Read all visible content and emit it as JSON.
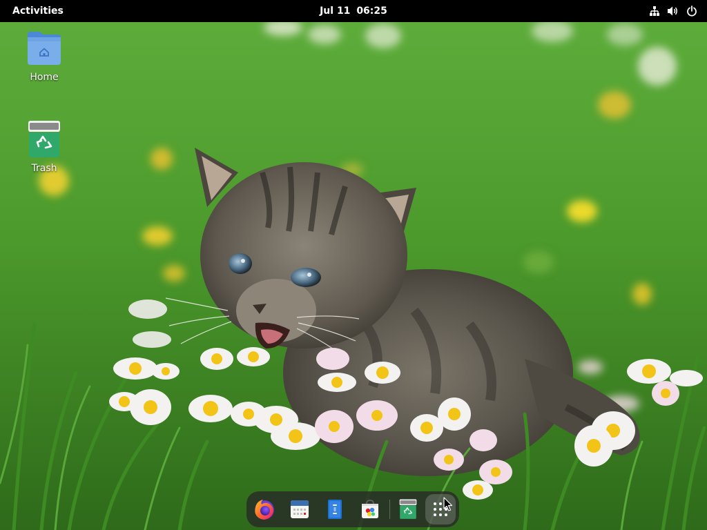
{
  "topbar": {
    "activities_label": "Activities",
    "date": "Jul 11",
    "time": "06:25",
    "status_icons": [
      "network-wired-icon",
      "volume-icon",
      "power-icon"
    ]
  },
  "desktop": {
    "icons": [
      {
        "label": "Home",
        "icon": "home-folder-icon"
      },
      {
        "label": "Trash",
        "icon": "trash-icon"
      }
    ]
  },
  "dock": {
    "items": [
      {
        "app": "firefox",
        "icon": "firefox-icon"
      },
      {
        "app": "calendar",
        "icon": "calendar-icon"
      },
      {
        "app": "files",
        "icon": "files-icon"
      },
      {
        "app": "software",
        "icon": "software-store-icon"
      },
      {
        "app": "trash",
        "icon": "trash-icon"
      },
      {
        "app": "show-apps",
        "icon": "app-grid-icon"
      }
    ]
  },
  "colors": {
    "topbar_bg": "#000000",
    "folder_blue": "#6ea2e3",
    "trash_green": "#2fa86a",
    "grass_green": "#4a9a2e"
  }
}
